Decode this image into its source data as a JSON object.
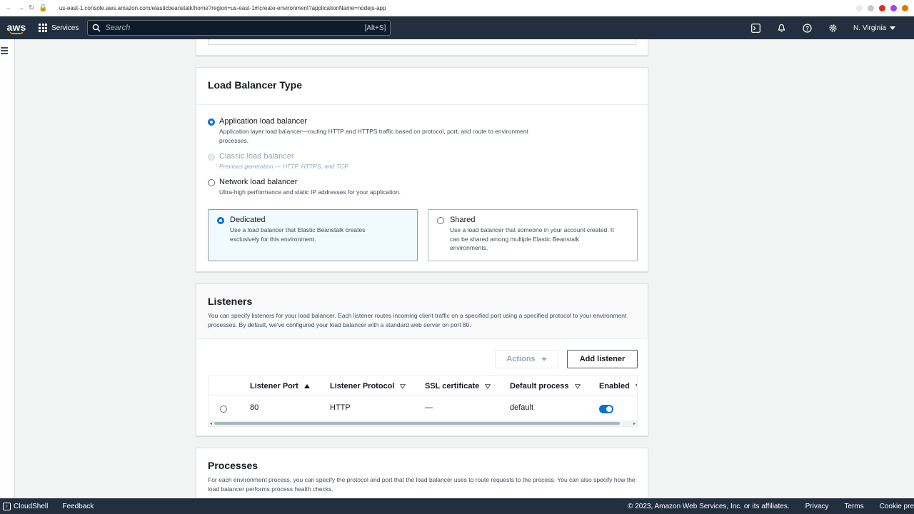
{
  "browser": {
    "url": "us-east-1.console.aws.amazon.com/elasticbeanstalk/home?region=us-east-1#/create-environment?applicationName=nodejs-app"
  },
  "topnav": {
    "logo": "aws",
    "services_label": "Services",
    "search_placeholder": "Search",
    "search_shortcut": "[Alt+S]",
    "region": "N. Virginia"
  },
  "load_balancer_type": {
    "title": "Load Balancer Type",
    "options": [
      {
        "label": "Application load balancer",
        "description": "Application layer load balancer—routing HTTP and HTTPS traffic based on protocol, port, and route to environment processes.",
        "selected": true,
        "disabled": false
      },
      {
        "label": "Classic load balancer",
        "description": "Previous generation — HTTP, HTTPS, and TCP",
        "selected": false,
        "disabled": true
      },
      {
        "label": "Network load balancer",
        "description": "Ultra-high performance and static IP addresses for your application.",
        "selected": false,
        "disabled": false
      }
    ],
    "tiles": [
      {
        "label": "Dedicated",
        "description": "Use a load balancer that Elastic Beanstalk creates exclusively for this environment.",
        "selected": true
      },
      {
        "label": "Shared",
        "description": "Use a load balancer that someone in your account created. It can be shared among multiple Elastic Beanstalk environments.",
        "selected": false
      }
    ]
  },
  "listeners": {
    "title": "Listeners",
    "description": "You can specify listeners for your load balancer. Each listener routes incoming client traffic on a specified port using a specified protocol to your environment processes. By default, we've configured your load balancer with a standard web server on port 80.",
    "actions_label": "Actions",
    "add_label": "Add listener",
    "columns": [
      "Listener Port",
      "Listener Protocol",
      "SSL certificate",
      "Default process",
      "Enabled"
    ],
    "rows": [
      {
        "port": "80",
        "protocol": "HTTP",
        "ssl": "—",
        "process": "default",
        "enabled": true
      }
    ]
  },
  "processes": {
    "title": "Processes",
    "description": "For each environment process, you can specify the protocol and port that the load balancer uses to route requests to the process. You can also specify how the load balancer performs process health checks."
  },
  "footer": {
    "cloudshell": "CloudShell",
    "feedback": "Feedback",
    "copyright": "© 2023, Amazon Web Services, Inc. or its affiliates.",
    "privacy": "Privacy",
    "terms": "Terms",
    "cookie": "Cookie pre"
  },
  "colors": {
    "nav_bg": "#232f3e",
    "accent": "#0972d3",
    "brand_orange": "#ff9900"
  }
}
